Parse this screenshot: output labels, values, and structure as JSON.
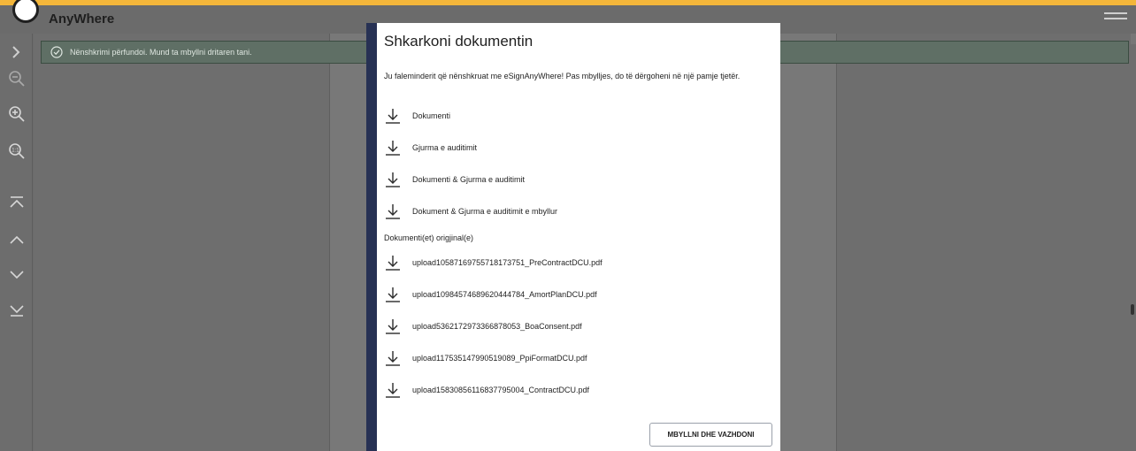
{
  "app": {
    "brand": "AnyWhere"
  },
  "notice": {
    "text": "Nënshkrimi përfundoi. Mund ta mbyllni dritaren tani."
  },
  "dialog": {
    "title": "Shkarkoni dokumentin",
    "message": "Ju faleminderit që nënshkruat me eSignAnyWhere! Pas mbylljes, do të dërgoheni në një pamje tjetër.",
    "downloads": [
      {
        "label": "Dokumenti"
      },
      {
        "label": "Gjurma e auditimit"
      },
      {
        "label": "Dokumenti & Gjurma e auditimit"
      },
      {
        "label": "Dokument & Gjurma e auditimit e mbyllur"
      }
    ],
    "originals_header": "Dokumenti(et) origjinal(e)",
    "originals": [
      {
        "label": "upload10587169755718173751_PreContractDCU.pdf"
      },
      {
        "label": "upload10984574689620444784_AmortPlanDCU.pdf"
      },
      {
        "label": "upload5362172973366878053_BoaConsent.pdf"
      },
      {
        "label": "upload117535147990519089_PpiFormatDCU.pdf"
      },
      {
        "label": "upload15830856116837795004_ContractDCU.pdf"
      }
    ],
    "button_label": "MBYLLNI DHE VAZHDONI"
  },
  "colors": {
    "top_accent": "#f4b63a",
    "dialog_accent": "#273154",
    "notice_bg": "#5f6f65"
  },
  "icons": {
    "toolbar": [
      "chevron-right-icon",
      "zoom-out-icon",
      "zoom-in-icon",
      "zoom-fit-icon",
      "first-page-icon",
      "prev-page-icon",
      "next-page-icon",
      "last-page-icon"
    ],
    "download": "download-icon",
    "notice": "check-circle-icon"
  }
}
